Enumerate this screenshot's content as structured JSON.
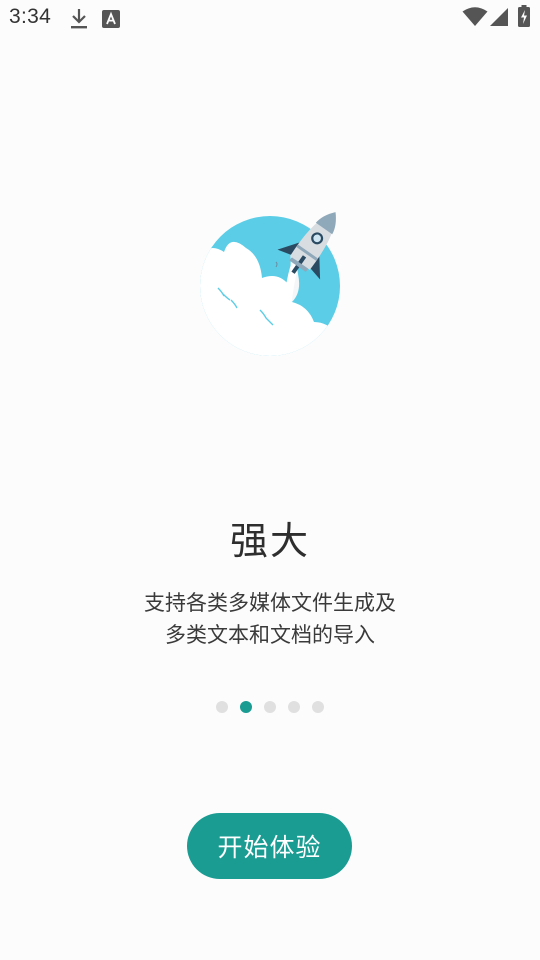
{
  "status_bar": {
    "time": "3:34",
    "icons": [
      "download-icon",
      "a-badge-icon",
      "wifi-icon",
      "cell-signal-icon",
      "battery-charging-icon"
    ]
  },
  "onboarding": {
    "illustration": "rocket-launch-illustration",
    "title": "强大",
    "description_lines": [
      "支持各类多媒体文件生成及",
      "多类文本和文档的导入"
    ],
    "pager": {
      "total": 5,
      "active_index": 1
    },
    "start_button_label": "开始体验"
  },
  "colors": {
    "accent": "#1a9c93",
    "dot_inactive": "#e0e0e0",
    "illustration_sky": "#5bcde6"
  }
}
